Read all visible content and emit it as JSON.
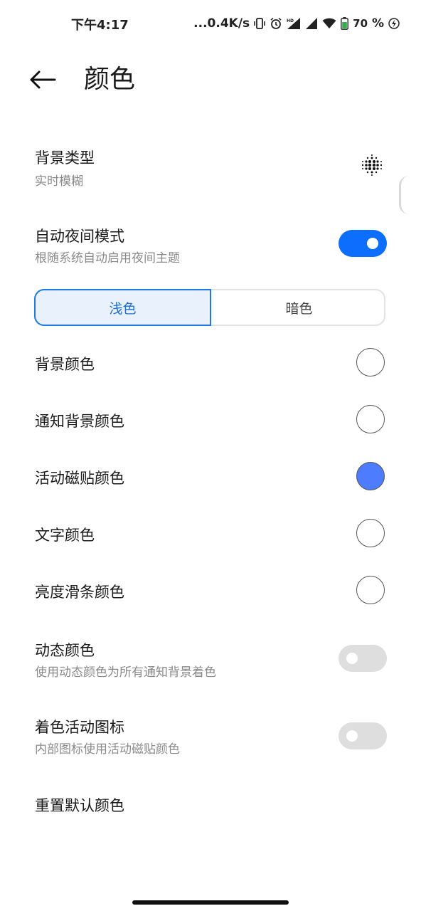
{
  "status_bar": {
    "time": "下午4:17",
    "net_speed": "...0.4K/s",
    "battery_pct": "70",
    "battery_pct_sign": "%"
  },
  "header": {
    "title": "颜色",
    "back_icon": "arrow-left-icon"
  },
  "settings": {
    "background_type": {
      "title": "背景类型",
      "subtitle": "实时模糊",
      "icon": "blur-dots-icon"
    },
    "auto_night": {
      "title": "自动夜间模式",
      "subtitle": "根随系统自动启用夜间主题",
      "enabled": true
    },
    "theme_tabs": {
      "light": "浅色",
      "dark": "暗色",
      "selected": "light"
    },
    "color_rows": [
      {
        "label": "背景颜色",
        "color": "#ffffff"
      },
      {
        "label": "通知背景颜色",
        "color": "#ffffff"
      },
      {
        "label": "活动磁贴颜色",
        "color": "#4d7cfe"
      },
      {
        "label": "文字颜色",
        "color": "#ffffff"
      },
      {
        "label": "亮度滑条颜色",
        "color": "#ffffff"
      }
    ],
    "dynamic_color": {
      "title": "动态颜色",
      "subtitle": "使用动态颜色为所有通知背景着色",
      "enabled": false
    },
    "tint_icons": {
      "title": "着色活动图标",
      "subtitle": "内部图标使用活动磁贴颜色",
      "enabled": false
    },
    "reset": {
      "label": "重置默认颜色"
    }
  },
  "colors": {
    "accent": "#0d6efd",
    "tab_selected_bg": "#e8f1fc"
  }
}
